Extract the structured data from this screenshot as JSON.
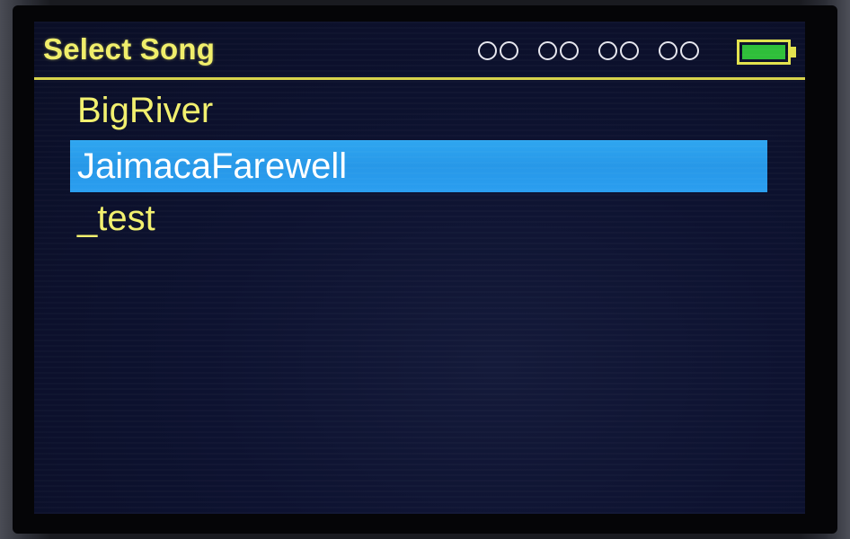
{
  "header": {
    "title": "Select Song",
    "indicator_pairs": 4,
    "battery": {
      "level": 1.0,
      "fill_color": "#2fbf3a"
    }
  },
  "songs": {
    "items": [
      {
        "label": "BigRiver",
        "selected": false
      },
      {
        "label": "JaimacaFarewell",
        "selected": true
      },
      {
        "label": "_test",
        "selected": false
      }
    ]
  },
  "colors": {
    "text": "#f2f06e",
    "selection": "#2a9ef0",
    "background": "#0d1230"
  }
}
